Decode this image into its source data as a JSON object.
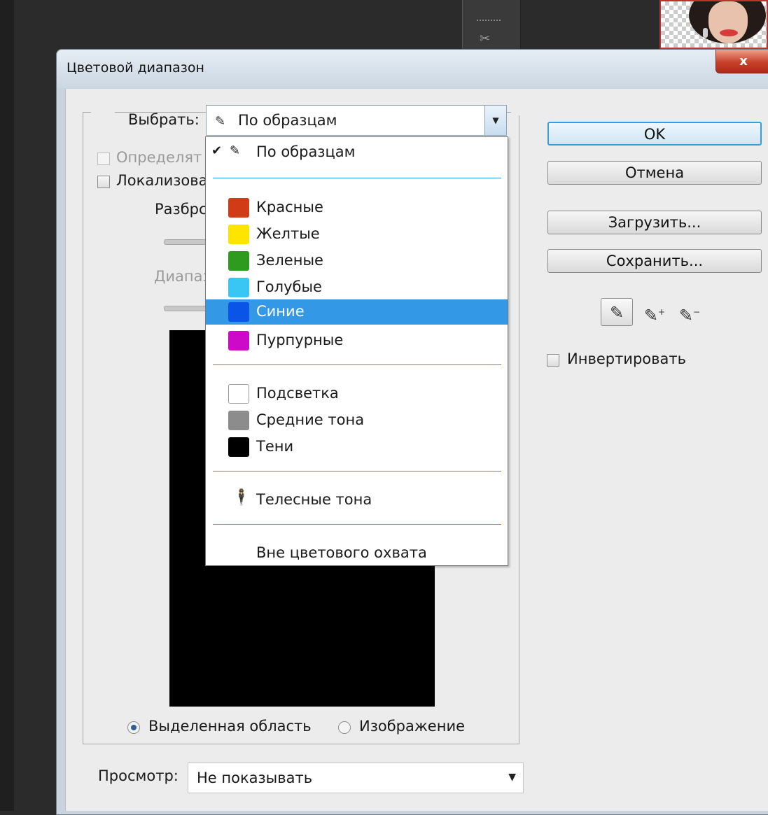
{
  "dialog": {
    "title": "Цветовой диапазон",
    "close_label": "x"
  },
  "select": {
    "label": "Выбрать:",
    "value": "По образцам"
  },
  "options_panel": {
    "detect_faces_label": "Определят",
    "localized_label": "Локализова",
    "fuzziness_label": "Разбрс",
    "range_label": "Диапаз"
  },
  "menu": {
    "items": [
      {
        "label": "По образцам",
        "swatch": "",
        "checked": true
      },
      {
        "label": "Красные",
        "swatch": "#d13b16"
      },
      {
        "label": "Желтые",
        "swatch": "#ffe400"
      },
      {
        "label": "Зеленые",
        "swatch": "#2e9a1e"
      },
      {
        "label": "Голубые",
        "swatch": "#39c6f4"
      },
      {
        "label": "Синие",
        "swatch": "#0a55e8",
        "selected": true
      },
      {
        "label": "Пурпурные",
        "swatch": "#cc0ac8"
      },
      {
        "label": "Подсветка",
        "swatch": "#ffffff"
      },
      {
        "label": "Средние тона",
        "swatch": "#8c8c8c"
      },
      {
        "label": "Тени",
        "swatch": "#000000"
      },
      {
        "label": "Телесные тона",
        "icon": "person-icon"
      },
      {
        "label": "Вне цветового охвата"
      }
    ],
    "highlight_color": "#3399e6"
  },
  "view_mode": {
    "selection_label": "Выделенная область",
    "image_label": "Изображение"
  },
  "preview": {
    "label": "Просмотр:",
    "value": "Не показывать"
  },
  "buttons": {
    "ok": "OK",
    "cancel": "Отмена",
    "load": "Загрузить...",
    "save": "Сохранить..."
  },
  "invert": {
    "label": "Инвертировать"
  }
}
